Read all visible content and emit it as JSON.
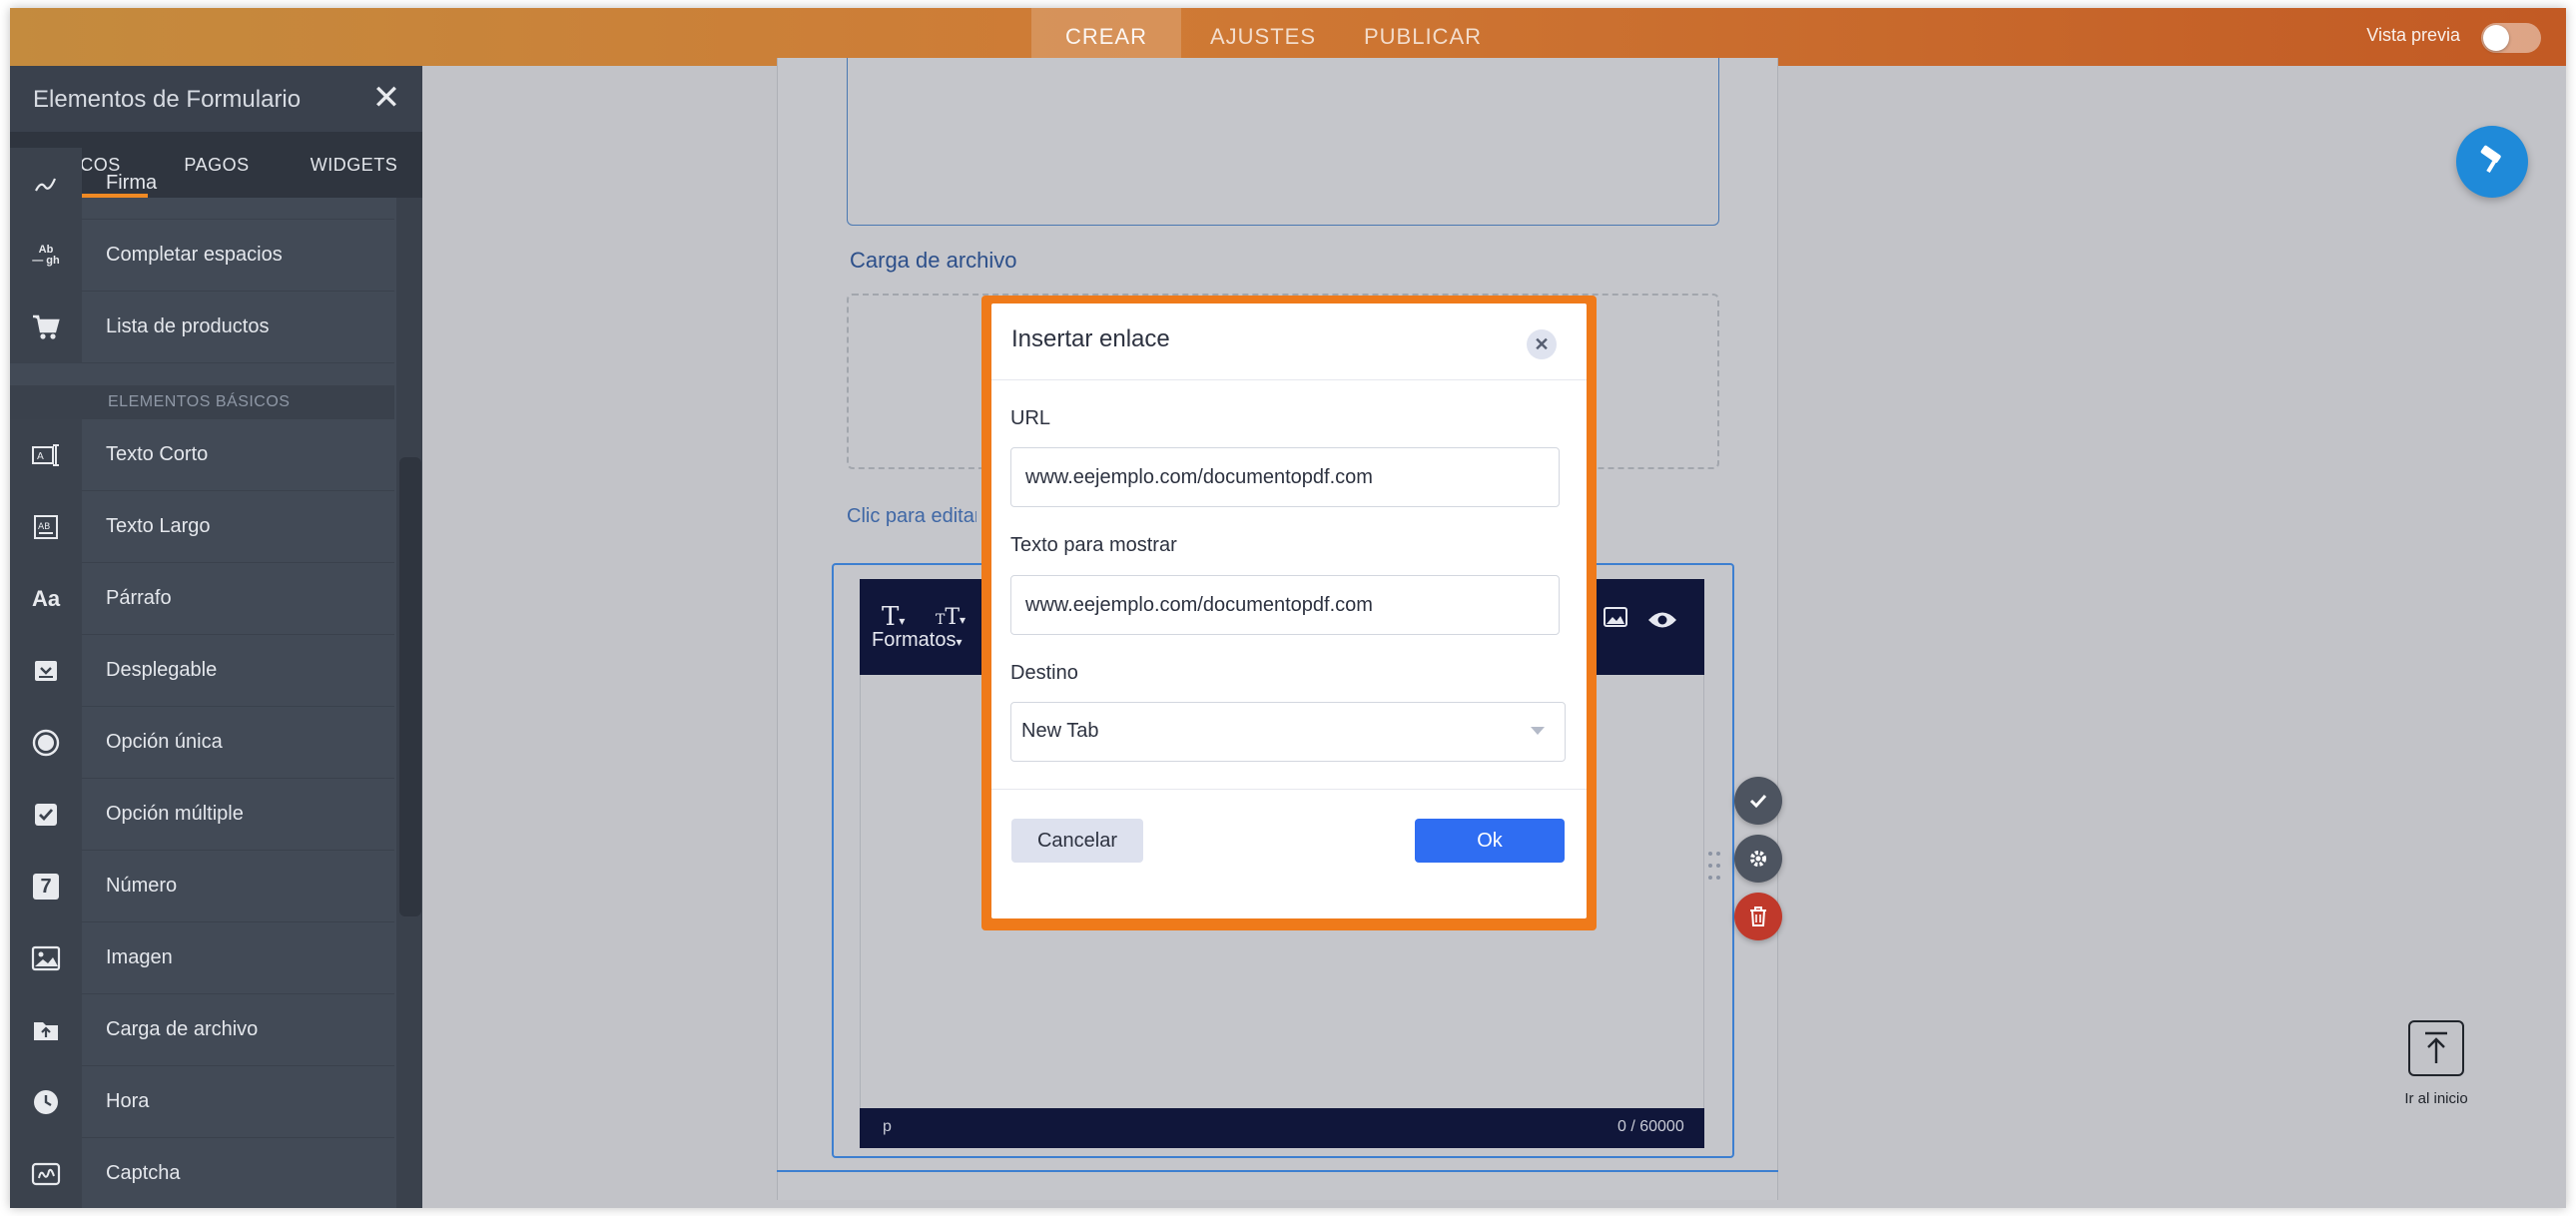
{
  "topbar": {
    "tabs": [
      "CREAR",
      "AJUSTES",
      "PUBLICAR"
    ],
    "active_tab": "CREAR",
    "preview_label": "Vista previa"
  },
  "sidebar": {
    "title": "Elementos de Formulario",
    "tabs": [
      "BÁSICOS",
      "PAGOS",
      "WIDGETS"
    ],
    "partial_item": "Firma",
    "items_top": [
      "Completar espacios",
      "Lista de productos"
    ],
    "section_label": "ELEMENTOS BÁSICOS",
    "items": [
      "Texto Corto",
      "Texto Largo",
      "Párrafo",
      "Desplegable",
      "Opción única",
      "Opción múltiple",
      "Número",
      "Imagen",
      "Carga de archivo",
      "Hora",
      "Captcha"
    ],
    "icon_texts": {
      "fill_blank": "Ab\n— gh",
      "paragraph": "Aa",
      "number": "7"
    }
  },
  "form": {
    "upload_label": "Carga de archivo",
    "click_edit": "Clic para editar",
    "toolbar_formats": "Formatos",
    "status_tag": "p",
    "char_count": "0 / 60000"
  },
  "modal": {
    "title": "Insertar enlace",
    "url_label": "URL",
    "url_value": "www.eejemplo.com/documentopdf.com",
    "text_label": "Texto para mostrar",
    "text_value": "www.eejemplo.com/documentopdf.com",
    "target_label": "Destino",
    "target_value": "New Tab",
    "cancel_label": "Cancelar",
    "ok_label": "Ok"
  },
  "floating": {
    "scroll_top_label": "Ir al inicio"
  },
  "colors": {
    "accent_orange": "#ef7a1a",
    "primary_blue": "#2f6df2",
    "sidebar_bg": "#424a56",
    "editor_toolbar": "#10163a",
    "delete_red": "#c0392b"
  }
}
